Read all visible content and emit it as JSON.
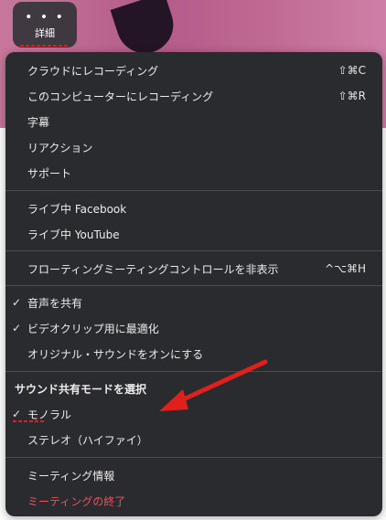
{
  "more_button": {
    "dots": "• • •",
    "label": "詳細"
  },
  "menu": {
    "sections": [
      {
        "items": [
          {
            "label": "クラウドにレコーディング",
            "shortcut": "⇧⌘C"
          },
          {
            "label": "このコンピューターにレコーディング",
            "shortcut": "⇧⌘R"
          },
          {
            "label": "字幕"
          },
          {
            "label": "リアクション"
          },
          {
            "label": "サポート"
          }
        ]
      },
      {
        "items": [
          {
            "label": "ライブ中 Facebook"
          },
          {
            "label": "ライブ中 YouTube"
          }
        ]
      },
      {
        "items": [
          {
            "label": "フローティングミーティングコントロールを非表示",
            "shortcut": "^⌥⌘H"
          }
        ]
      },
      {
        "items": [
          {
            "label": "音声を共有",
            "checked": true
          },
          {
            "label": "ビデオクリップ用に最適化",
            "checked": true
          },
          {
            "label": "オリジナル・サウンドをオンにする"
          }
        ]
      },
      {
        "header": "サウンド共有モードを選択",
        "items": [
          {
            "label": "モノラル",
            "checked": true
          },
          {
            "label": "ステレオ（ハイファイ）"
          }
        ]
      },
      {
        "items": [
          {
            "label": "ミーティング情報"
          },
          {
            "label": "ミーティングの終了",
            "danger": true
          }
        ]
      }
    ],
    "check_glyph": "✓"
  },
  "colors": {
    "menu_bg": "#2a2b2e",
    "text": "#ececec",
    "danger": "#e8555a",
    "annotation": "#e0201c"
  }
}
